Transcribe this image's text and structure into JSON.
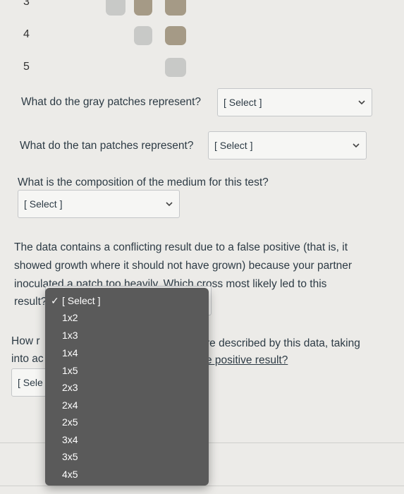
{
  "rows": {
    "row3": "3",
    "row4": "4",
    "row5": "5"
  },
  "colors": {
    "gray_patch": "#c8c9c7",
    "tan_patch": "#a59a86",
    "dropdown_bg": "#5a5a5a"
  },
  "questions": {
    "gray": {
      "text": "What do the gray patches represent?",
      "select": "[ Select ]"
    },
    "tan": {
      "text": "What do the tan patches represent?",
      "select": "[ Select ]"
    },
    "medium": {
      "text": "What is the composition of the medium for this test?",
      "select": "[ Select ]"
    },
    "conflict": {
      "paragraph": "The data contains a conflicting result due to a false positive (that is, it showed growth where it should not have grown) because your partner inoculated a patch too heavily. Which cross most likely led to this",
      "result_label": "result?"
    },
    "how_many": {
      "line1_start": "How r",
      "line1_end": "re described by this data, taking",
      "line2_start": "into ac",
      "line2_end": "e positive result?",
      "select_partial": "[ Sele"
    }
  },
  "dropdown": {
    "options": [
      "[ Select ]",
      "1x2",
      "1x3",
      "1x4",
      "1x5",
      "2x3",
      "2x4",
      "2x5",
      "3x4",
      "3x5",
      "4x5"
    ],
    "selected_index": 0,
    "check_icon": "check-icon"
  }
}
